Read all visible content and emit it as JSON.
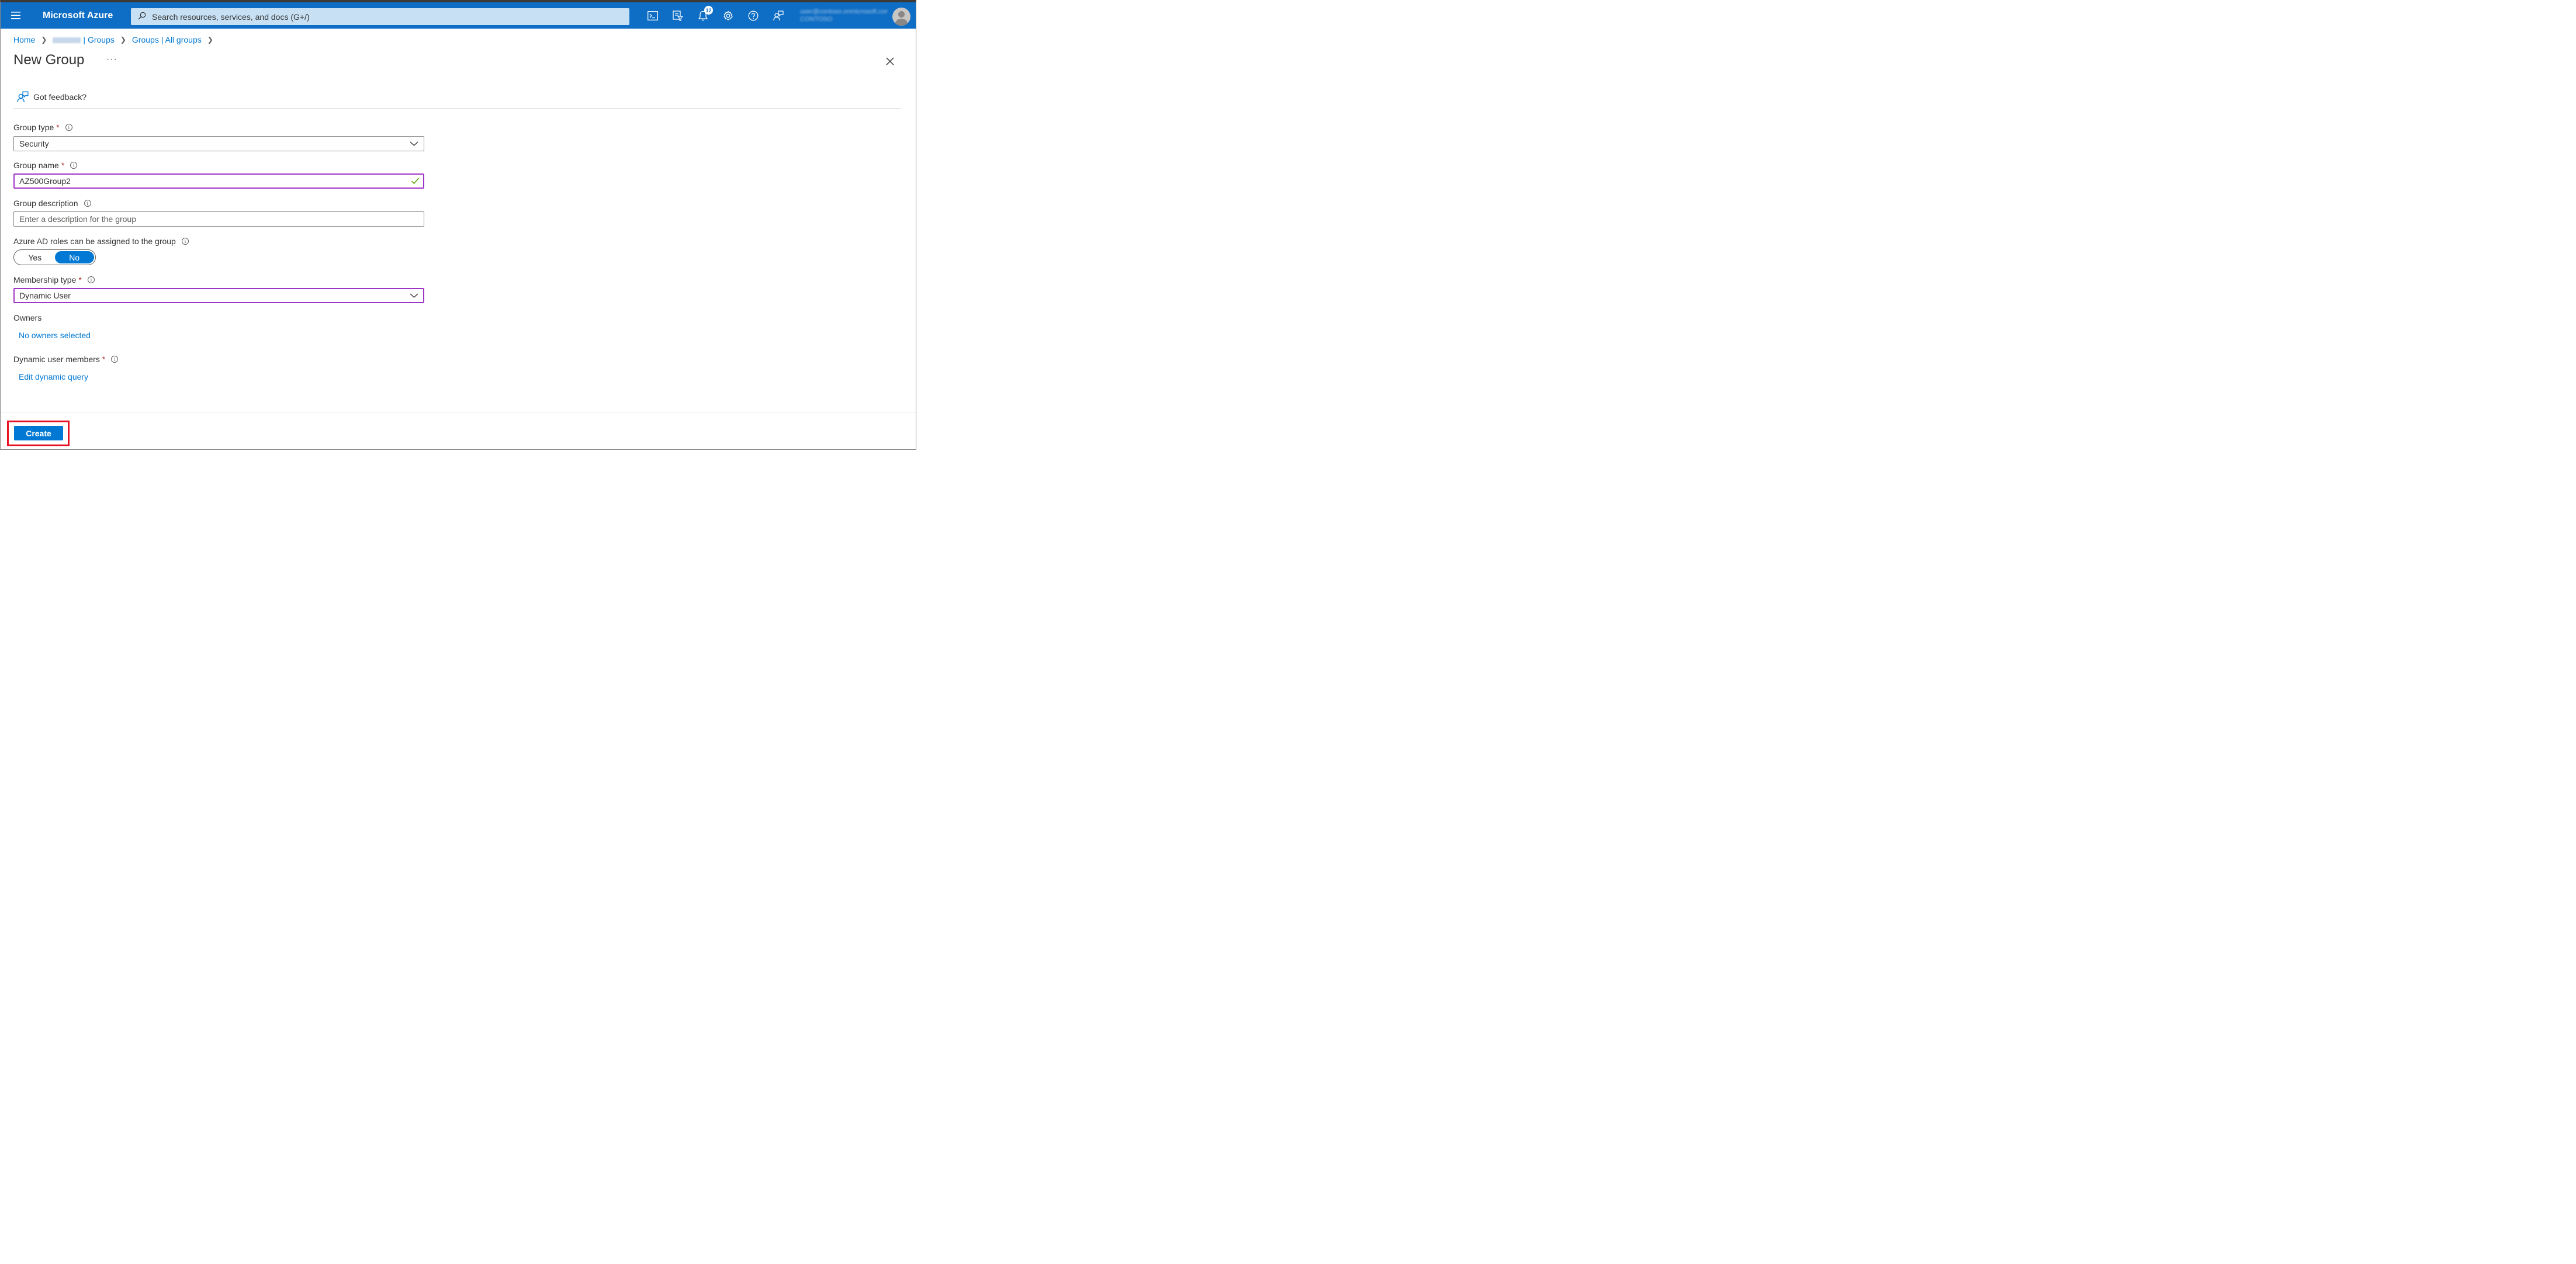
{
  "topbar": {
    "brand": "Microsoft Azure",
    "search_placeholder": "Search resources, services, and docs (G+/)",
    "notification_count": "12",
    "account_text": "user@contoso.onmicrosoft.com\nCONTOSO",
    "icons": [
      "menu-icon",
      "cloud-shell-icon",
      "directory-filter-icon",
      "notifications-icon",
      "settings-icon",
      "help-icon",
      "feedback-icon",
      "avatar"
    ]
  },
  "breadcrumb": {
    "home": "Home",
    "groups": "| Groups",
    "all_groups": "Groups | All groups"
  },
  "page": {
    "title": "New Group",
    "more": "···",
    "feedback": "Got feedback?"
  },
  "form": {
    "group_type": {
      "label": "Group type",
      "value": "Security"
    },
    "group_name": {
      "label": "Group name",
      "value": "AZ500Group2"
    },
    "group_description": {
      "label": "Group description",
      "placeholder": "Enter a description for the group"
    },
    "azure_ad_roles": {
      "label": "Azure AD roles can be assigned to the group",
      "yes": "Yes",
      "no": "No",
      "selected": "No"
    },
    "membership_type": {
      "label": "Membership type",
      "value": "Dynamic User"
    },
    "owners": {
      "label": "Owners",
      "link": "No owners selected"
    },
    "dynamic_members": {
      "label": "Dynamic user members",
      "link": "Edit dynamic query"
    },
    "required_marker": "*"
  },
  "footer": {
    "create_label": "Create"
  },
  "colors": {
    "accent": "#0078d4",
    "topbar": "#0e6dc4",
    "required": "#a4262c",
    "valid": "#57a300",
    "focus": "#a033c8",
    "highlight": "#e81123"
  }
}
